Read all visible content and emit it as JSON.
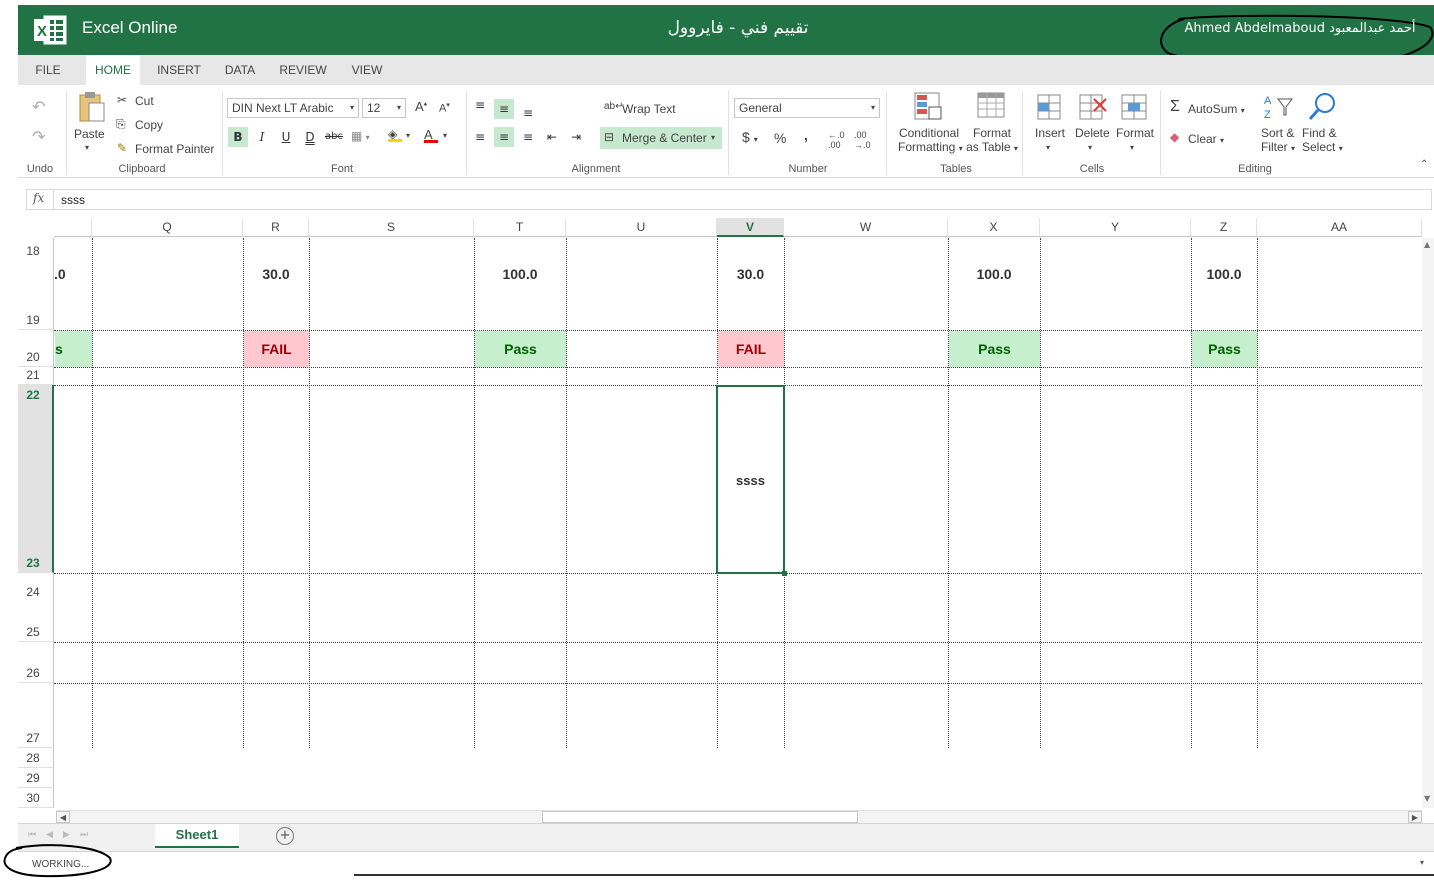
{
  "titlebar": {
    "app_name": "Excel Online",
    "doc_title": "تقييم فني - فايروول",
    "user_name": "Ahmed Abdelmaboud أحمد عبدالمعبود",
    "bg_color": "#217346"
  },
  "tabs": [
    "FILE",
    "HOME",
    "INSERT",
    "DATA",
    "REVIEW",
    "VIEW"
  ],
  "active_tab": "HOME",
  "ribbon": {
    "undo_group": "Undo",
    "clipboard": {
      "paste": "Paste",
      "cut": "Cut",
      "copy": "Copy",
      "format_painter": "Format Painter",
      "group": "Clipboard"
    },
    "font": {
      "name": "DIN Next LT Arabic",
      "size": "12",
      "bold": "B",
      "italic": "I",
      "underline": "U",
      "double_underline": "D",
      "strike": "abc",
      "group": "Font"
    },
    "alignment": {
      "wrap_text": "Wrap Text",
      "merge_center": "Merge & Center",
      "group": "Alignment"
    },
    "number": {
      "format": "General",
      "currency": "$",
      "percent": "%",
      "comma": ",",
      "group": "Number"
    },
    "tables": {
      "conditional_1": "Conditional",
      "conditional_2": "Formatting",
      "format_table_1": "Format",
      "format_table_2": "as Table",
      "group": "Tables"
    },
    "cells": {
      "insert": "Insert",
      "delete": "Delete",
      "format": "Format",
      "group": "Cells"
    },
    "editing": {
      "autosum": "AutoSum",
      "clear": "Clear",
      "sort_1": "Sort &",
      "sort_2": "Filter",
      "find_1": "Find &",
      "find_2": "Select",
      "group": "Editing"
    }
  },
  "formula_bar": {
    "fx": "fx",
    "value": "ssss"
  },
  "grid": {
    "columns": [
      "Q",
      "R",
      "S",
      "T",
      "U",
      "V",
      "W",
      "X",
      "Y",
      "Z",
      "AA"
    ],
    "selected_column": "V",
    "rows": [
      "18",
      "19",
      "20",
      "21",
      "22",
      "23",
      "24",
      "25",
      "26",
      "27",
      "28",
      "29",
      "30"
    ],
    "selected_rows": [
      "22",
      "23"
    ],
    "partial_cells": {
      "row18_left": ".0",
      "row20_left": "s"
    },
    "row18": {
      "R": "30.0",
      "T": "100.0",
      "V": "30.0",
      "X": "100.0",
      "Z": "100.0"
    },
    "row20": {
      "R": "FAIL",
      "T": "Pass",
      "V": "FAIL",
      "X": "Pass",
      "Z": "Pass"
    },
    "active_cell": {
      "ref": "V22",
      "value": "ssss"
    },
    "fail_color": "#ffc7ce",
    "pass_color": "#c6efce"
  },
  "sheet_tabs": [
    "Sheet1"
  ],
  "status": "WORKING..."
}
